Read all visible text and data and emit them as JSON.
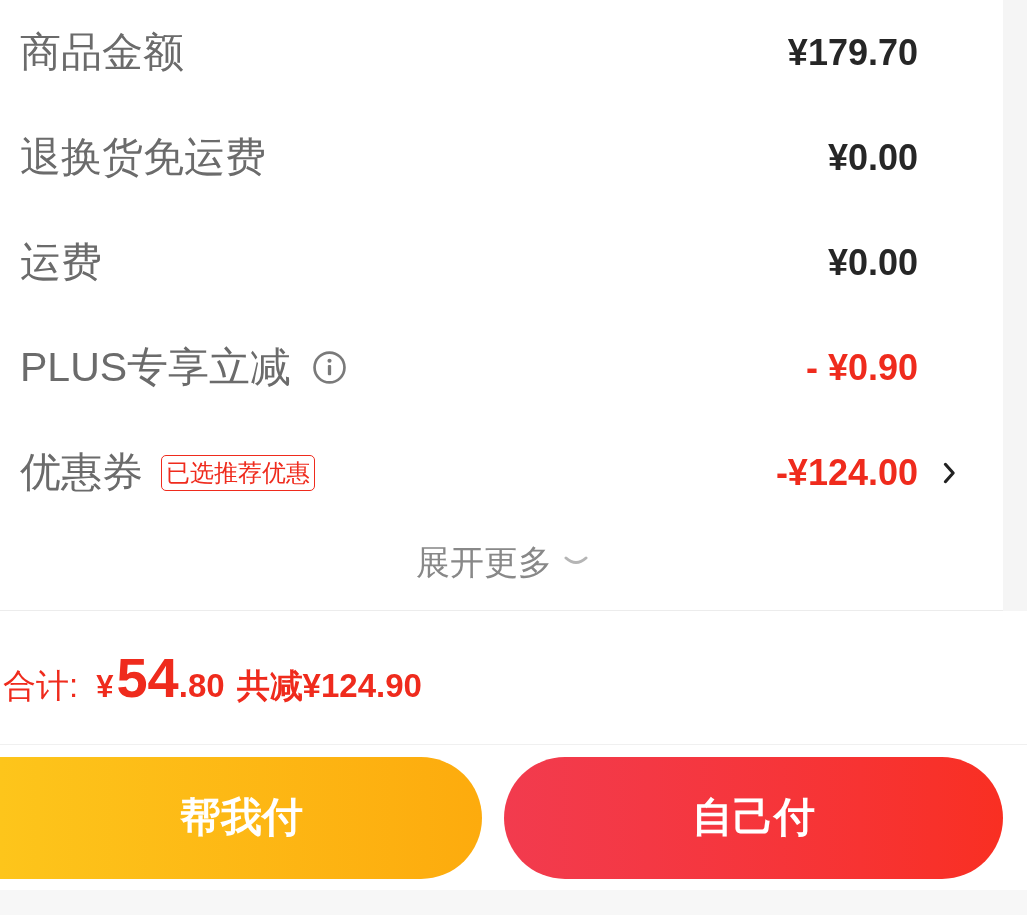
{
  "price_rows": [
    {
      "label": "商品金额",
      "amount": "¥179.70",
      "kind": "plain",
      "info": false,
      "chevron": false
    },
    {
      "label": "退换货免运费",
      "amount": "¥0.00",
      "kind": "plain",
      "info": false,
      "chevron": false
    },
    {
      "label": "运费",
      "amount": "¥0.00",
      "kind": "plain",
      "info": false,
      "chevron": false
    },
    {
      "label": "PLUS专享立减",
      "amount": "- ¥0.90",
      "kind": "discount",
      "info": true,
      "chevron": false
    },
    {
      "label": "优惠券",
      "tag": "已选推荐优惠",
      "amount": "-¥124.00",
      "kind": "discount",
      "info": false,
      "chevron": true
    }
  ],
  "expand": {
    "label": "展开更多"
  },
  "total": {
    "label": "合计:",
    "currency": "¥",
    "integer": "54",
    "decimal": ".80",
    "saving": "共减¥124.90"
  },
  "buttons": [
    {
      "label": "帮我付",
      "kind": "helper"
    },
    {
      "label": "自己付",
      "kind": "self"
    }
  ]
}
